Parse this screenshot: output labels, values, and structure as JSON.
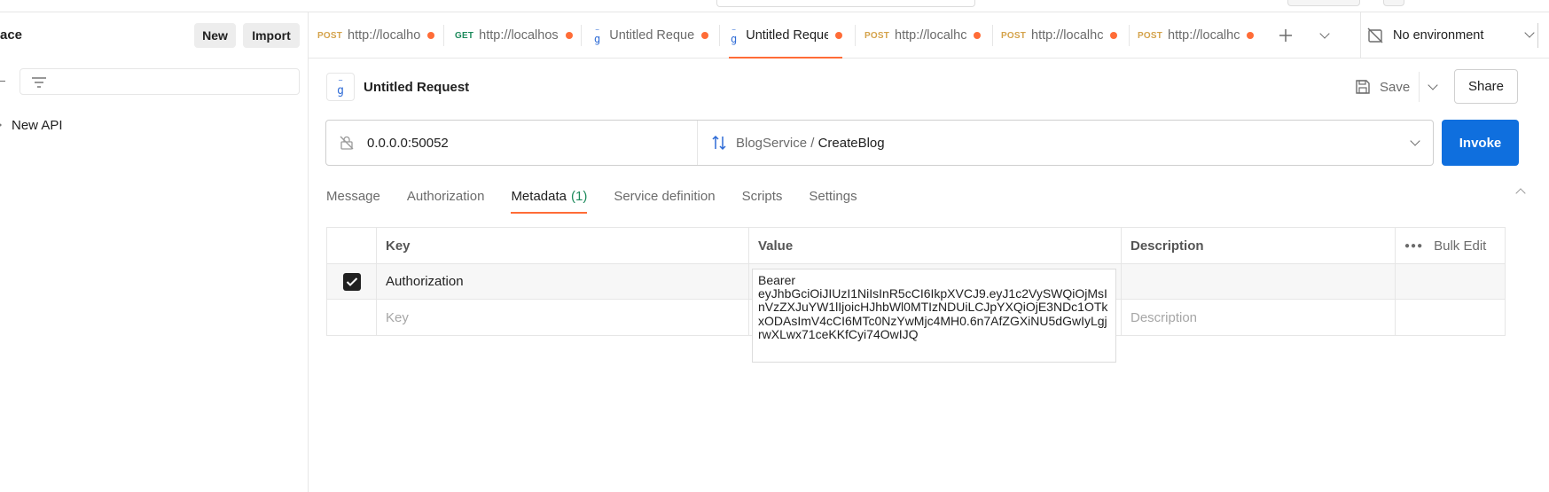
{
  "sidebar": {
    "workspace_title": "ace",
    "new_label": "New",
    "import_label": "Import",
    "tree": [
      {
        "label": "New API"
      }
    ]
  },
  "tabs": [
    {
      "method": "POST",
      "label": "http://localho",
      "unsaved": true
    },
    {
      "method": "GET",
      "label": "http://localhos",
      "unsaved": true
    },
    {
      "method": "gRPC",
      "label": "Untitled Reque",
      "unsaved": true
    },
    {
      "method": "gRPC",
      "label": "Untitled Reque",
      "unsaved": true,
      "active": true
    },
    {
      "method": "POST",
      "label": "http://localhc",
      "unsaved": true
    },
    {
      "method": "POST",
      "label": "http://localhc",
      "unsaved": true
    },
    {
      "method": "POST",
      "label": "http://localhc",
      "unsaved": true
    }
  ],
  "environment": {
    "label": "No environment"
  },
  "request": {
    "title": "Untitled Request",
    "save_label": "Save",
    "share_label": "Share",
    "server_url": "0.0.0.0:50052",
    "service": "BlogService",
    "separator": " / ",
    "method": "CreateBlog",
    "invoke_label": "Invoke"
  },
  "subtabs": [
    {
      "label": "Message"
    },
    {
      "label": "Authorization"
    },
    {
      "label": "Metadata",
      "count": "(1)",
      "active": true
    },
    {
      "label": "Service definition"
    },
    {
      "label": "Scripts"
    },
    {
      "label": "Settings"
    }
  ],
  "metadata_table": {
    "headers": {
      "key": "Key",
      "value": "Value",
      "description": "Description",
      "bulk_edit": "Bulk Edit"
    },
    "rows": [
      {
        "checked": true,
        "key": "Authorization",
        "value": "Bearer eyJhbGciOiJIUzI1NiIsInR5cCI6IkpXVCJ9.eyJ1c2VySWQiOjMsInVzZXJuYW1lIjoicHJhbWl0MTIzNDUiLCJpYXQiOjE3NDc1OTkxODAsImV4cCI6MTc0NzYwMjc4MH0.6n7AfZGXiNU5dGwIyLgjrwXLwx71ceKKfCyi74OwIJQ",
        "description": ""
      }
    ],
    "placeholder": {
      "key": "Key",
      "description": "Description"
    }
  },
  "token_display": {
    "line1": "Bearer",
    "body": "eyJhbGciOiJIUzI1NiIsInR5cCI6IkpXVCJ9.eyJ1c2VySWQiOjMsInVzZXJuYW1lIjoicHJhbWl0MTIzNDUiLCJpYXQiOjE3NDc1OTkxODAsImV4cCI6MTc0NzYwMjc4MH0.6n7AfZGXiNU5dGwIyLgjrwXLwx71ceKKfCyi74OwIJQ"
  },
  "colors": {
    "accent": "#ff6c37",
    "primary": "#0f6fde",
    "get_method": "#1d8a5c",
    "post_method": "#d4a24a"
  }
}
